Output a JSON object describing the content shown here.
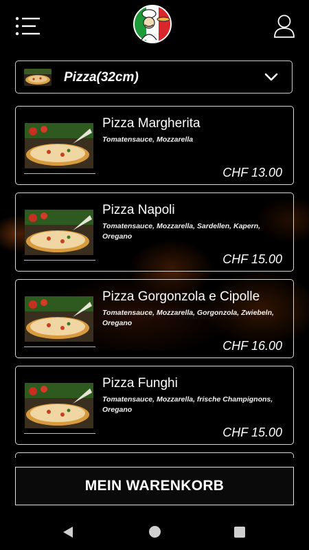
{
  "header": {
    "menu_icon": "menu-list-icon",
    "logo_icon": "pizza-chef-logo",
    "user_icon": "user-account-icon"
  },
  "category": {
    "label": "Pizza(32cm)",
    "thumb_icon": "pizza-thumbnail",
    "chevron_icon": "chevron-down-icon"
  },
  "products": [
    {
      "name": "Pizza Margherita",
      "description": "Tomatensauce, Mozzarella",
      "price": "CHF 13.00"
    },
    {
      "name": "Pizza Napoli",
      "description": "Tomatensauce, Mozzarella, Sardellen, Kapern, Oregano",
      "price": "CHF 15.00"
    },
    {
      "name": "Pizza Gorgonzola e Cipolle",
      "description": "Tomatensauce, Mozzarella, Gorgonzola, Zwiebeln, Oregano",
      "price": "CHF 16.00"
    },
    {
      "name": "Pizza Funghi",
      "description": "Tomatensauce, Mozzarella, frische Champignons, Oregano",
      "price": "CHF 15.00"
    }
  ],
  "cart": {
    "label": "MEIN WARENKORB"
  },
  "colors": {
    "background": "#000000",
    "border": "#d8d8d8",
    "text": "#ffffff"
  }
}
